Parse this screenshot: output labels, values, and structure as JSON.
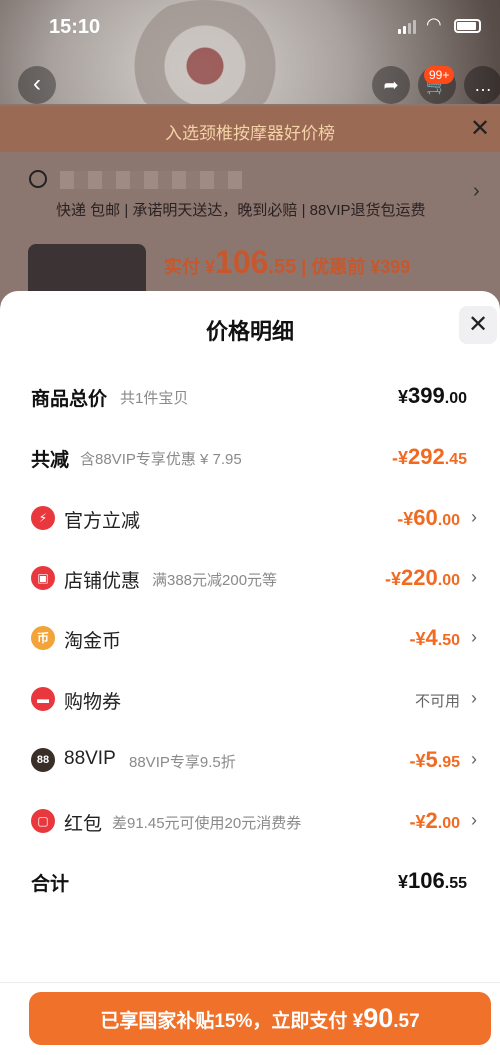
{
  "status": {
    "time": "15:10"
  },
  "background": {
    "cart_badge": "99+",
    "rank_text": "入选颈椎按摩器好价榜",
    "shipping": [
      "快递 包邮",
      "承诺明天送达，晚到必赔",
      "88VIP退货包运费"
    ],
    "price_prefix": "实付 ¥",
    "price_int": "106",
    "price_dec": ".55",
    "price_before": " | 优惠前 ¥399"
  },
  "sheet": {
    "title": "价格明细",
    "close_icon": "close-icon",
    "rows": [
      {
        "label": "商品总价",
        "sub": "共1件宝贝",
        "sign": "¥",
        "int": "399",
        "dec": ".00",
        "type": "total"
      },
      {
        "label": "共减",
        "sub": "含88VIP专享优惠 ¥ 7.95",
        "sign": "-¥",
        "int": "292",
        "dec": ".45",
        "type": "reduce"
      },
      {
        "label": "官方立减",
        "sub": "",
        "sign": "-¥",
        "int": "60",
        "dec": ".00",
        "icon": "lightning-icon",
        "color": "#e8383d"
      },
      {
        "label": "店铺优惠",
        "sub": "满388元减200元等",
        "sign": "-¥",
        "int": "220",
        "dec": ".00",
        "icon": "shop-icon",
        "color": "#e8383d"
      },
      {
        "label": "淘金币",
        "sub": "",
        "sign": "-¥",
        "int": "4",
        "dec": ".50",
        "icon": "coin-icon",
        "color": "#f2a33a"
      },
      {
        "label": "购物券",
        "sub": "",
        "status": "不可用",
        "icon": "ticket-icon",
        "color": "#e8383d"
      },
      {
        "label": "88VIP",
        "sub": "88VIP专享9.5折",
        "sign": "-¥",
        "int": "5",
        "dec": ".95",
        "icon": "vip-icon",
        "color": "#3a2e28"
      },
      {
        "label": "红包",
        "sub": "差91.45元可使用20元消费券",
        "sign": "-¥",
        "int": "2",
        "dec": ".00",
        "icon": "red-packet-icon",
        "color": "#e8383d"
      },
      {
        "label": "合计",
        "sub": "",
        "sign": "¥",
        "int": "106",
        "dec": ".55",
        "type": "sum"
      }
    ],
    "pay_button": {
      "text": "已享国家补贴15%，立即支付 ¥",
      "int": "90",
      "dec": ".57"
    }
  },
  "colors": {
    "accent": "#f26a21",
    "button": "#f0712a",
    "danger": "#e8383d"
  }
}
